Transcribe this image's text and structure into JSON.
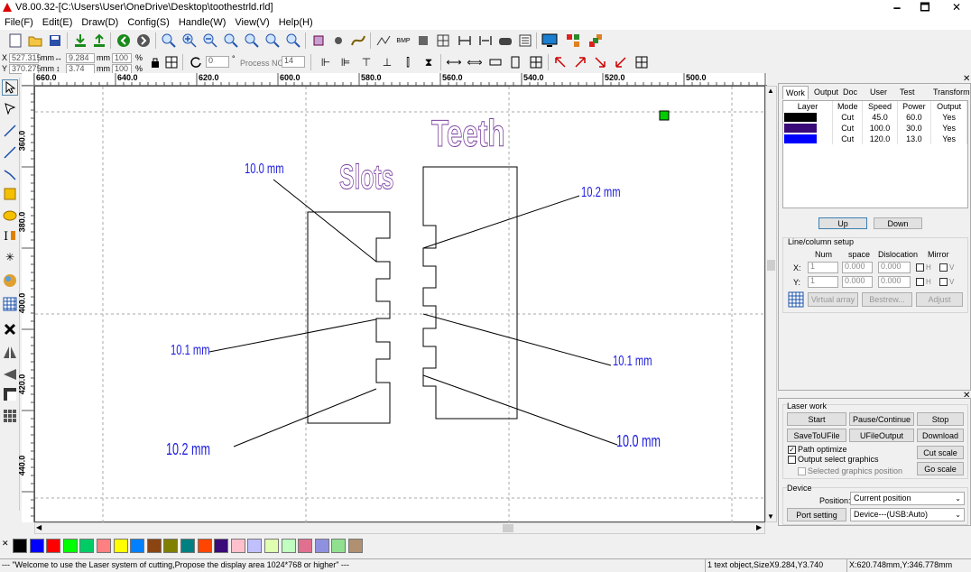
{
  "window": {
    "title": "V8.00.32-[C:\\Users\\User\\OneDrive\\Desktop\\toothestrld.rld]",
    "minimize": "🗕",
    "maximize": "🗖",
    "close": "✕"
  },
  "menu": [
    "File(F)",
    "Edit(E)",
    "Draw(D)",
    "Config(S)",
    "Handle(W)",
    "View(V)",
    "Help(H)"
  ],
  "coords": {
    "x_label": "X",
    "x_value": "527.315",
    "x_unit": "mm",
    "y_label": "Y",
    "y_value": "370.275",
    "y_unit": "mm",
    "w_value": "9.284",
    "w_unit": "mm",
    "h_value": "3.74",
    "h_unit": "mm",
    "sx_value": "100",
    "sx_unit": "%",
    "sy_value": "100",
    "sy_unit": "%",
    "rotate_value": "0",
    "rotate_unit": "°",
    "process_no_label": "Process NO:",
    "process_no_value": "14"
  },
  "hruler_labels": [
    "660.0",
    "640.0",
    "620.0",
    "600.0",
    "580.0",
    "560.0",
    "540.0",
    "520.0",
    "500.0"
  ],
  "vruler_labels": [
    "360.0",
    "380.0",
    "400.0",
    "420.0",
    "440.0"
  ],
  "canvas": {
    "title_teeth": "Teeth",
    "title_slots": "Slots",
    "annotations": [
      "10.0 mm",
      "10.2 mm",
      "10.1 mm",
      "10.1 mm",
      "10.2 mm",
      "10.0 mm"
    ]
  },
  "panel": {
    "tabs": [
      "Work",
      "Output",
      "Doc",
      "User",
      "Test",
      "Transform"
    ],
    "layer_headers": [
      "Layer",
      "Mode",
      "Speed",
      "Power",
      "Output"
    ],
    "layers": [
      {
        "color": "#000000",
        "mode": "Cut",
        "speed": "45.0",
        "power": "60.0",
        "output": "Yes"
      },
      {
        "color": "#3a0a78",
        "mode": "Cut",
        "speed": "100.0",
        "power": "30.0",
        "output": "Yes"
      },
      {
        "color": "#0000ff",
        "mode": "Cut",
        "speed": "120.0",
        "power": "13.0",
        "output": "Yes"
      }
    ],
    "up": "Up",
    "down": "Down",
    "line_column_setup": "Line/column setup",
    "num": "Num",
    "space": "space",
    "dislocation": "Dislocation",
    "mirror": "Mirror",
    "x_row": {
      "label": "X:",
      "num": "1",
      "space": "0.000",
      "disloc": "0.000",
      "h": "H",
      "v": "V"
    },
    "y_row": {
      "label": "Y:",
      "num": "1",
      "space": "0.000",
      "disloc": "0.000",
      "h": "H",
      "v": "V"
    },
    "virtual_array": "Virtual array",
    "bestrew": "Bestrew...",
    "adjust": "Adjust"
  },
  "laser": {
    "group": "Laser work",
    "start": "Start",
    "pause": "Pause/Continue",
    "stop": "Stop",
    "save_u": "SaveToUFile",
    "ufile_output": "UFileOutput",
    "download": "Download",
    "path_optimize": "Path optimize",
    "path_optimize_checked": true,
    "output_select": "Output select graphics",
    "selected_pos": "Selected graphics position",
    "cut_scale": "Cut scale",
    "go_scale": "Go scale",
    "device_group": "Device",
    "position_label": "Position:",
    "position_value": "Current position",
    "port_setting": "Port setting",
    "device_value": "Device---(USB:Auto)"
  },
  "palette": [
    "#000000",
    "#0000ff",
    "#ff0000",
    "#00ff00",
    "#00cc66",
    "#ff8080",
    "#ffff00",
    "#0080ff",
    "#8b4513",
    "#808000",
    "#008080",
    "#ff4500",
    "#3a0a78",
    "#ffc0cb",
    "#c0c0ff",
    "#e0ffb0",
    "#c0ffc0",
    "#e07090",
    "#9090e0",
    "#90e090",
    "#b09070"
  ],
  "status": {
    "welcome": "--- \"Welcome to use the Laser system of cutting,Propose the display area 1024*768 or higher\" ---",
    "selection": "1 text object,SizeX9.284,Y3.740",
    "cursor": "X:620.748mm,Y:346.778mm"
  }
}
